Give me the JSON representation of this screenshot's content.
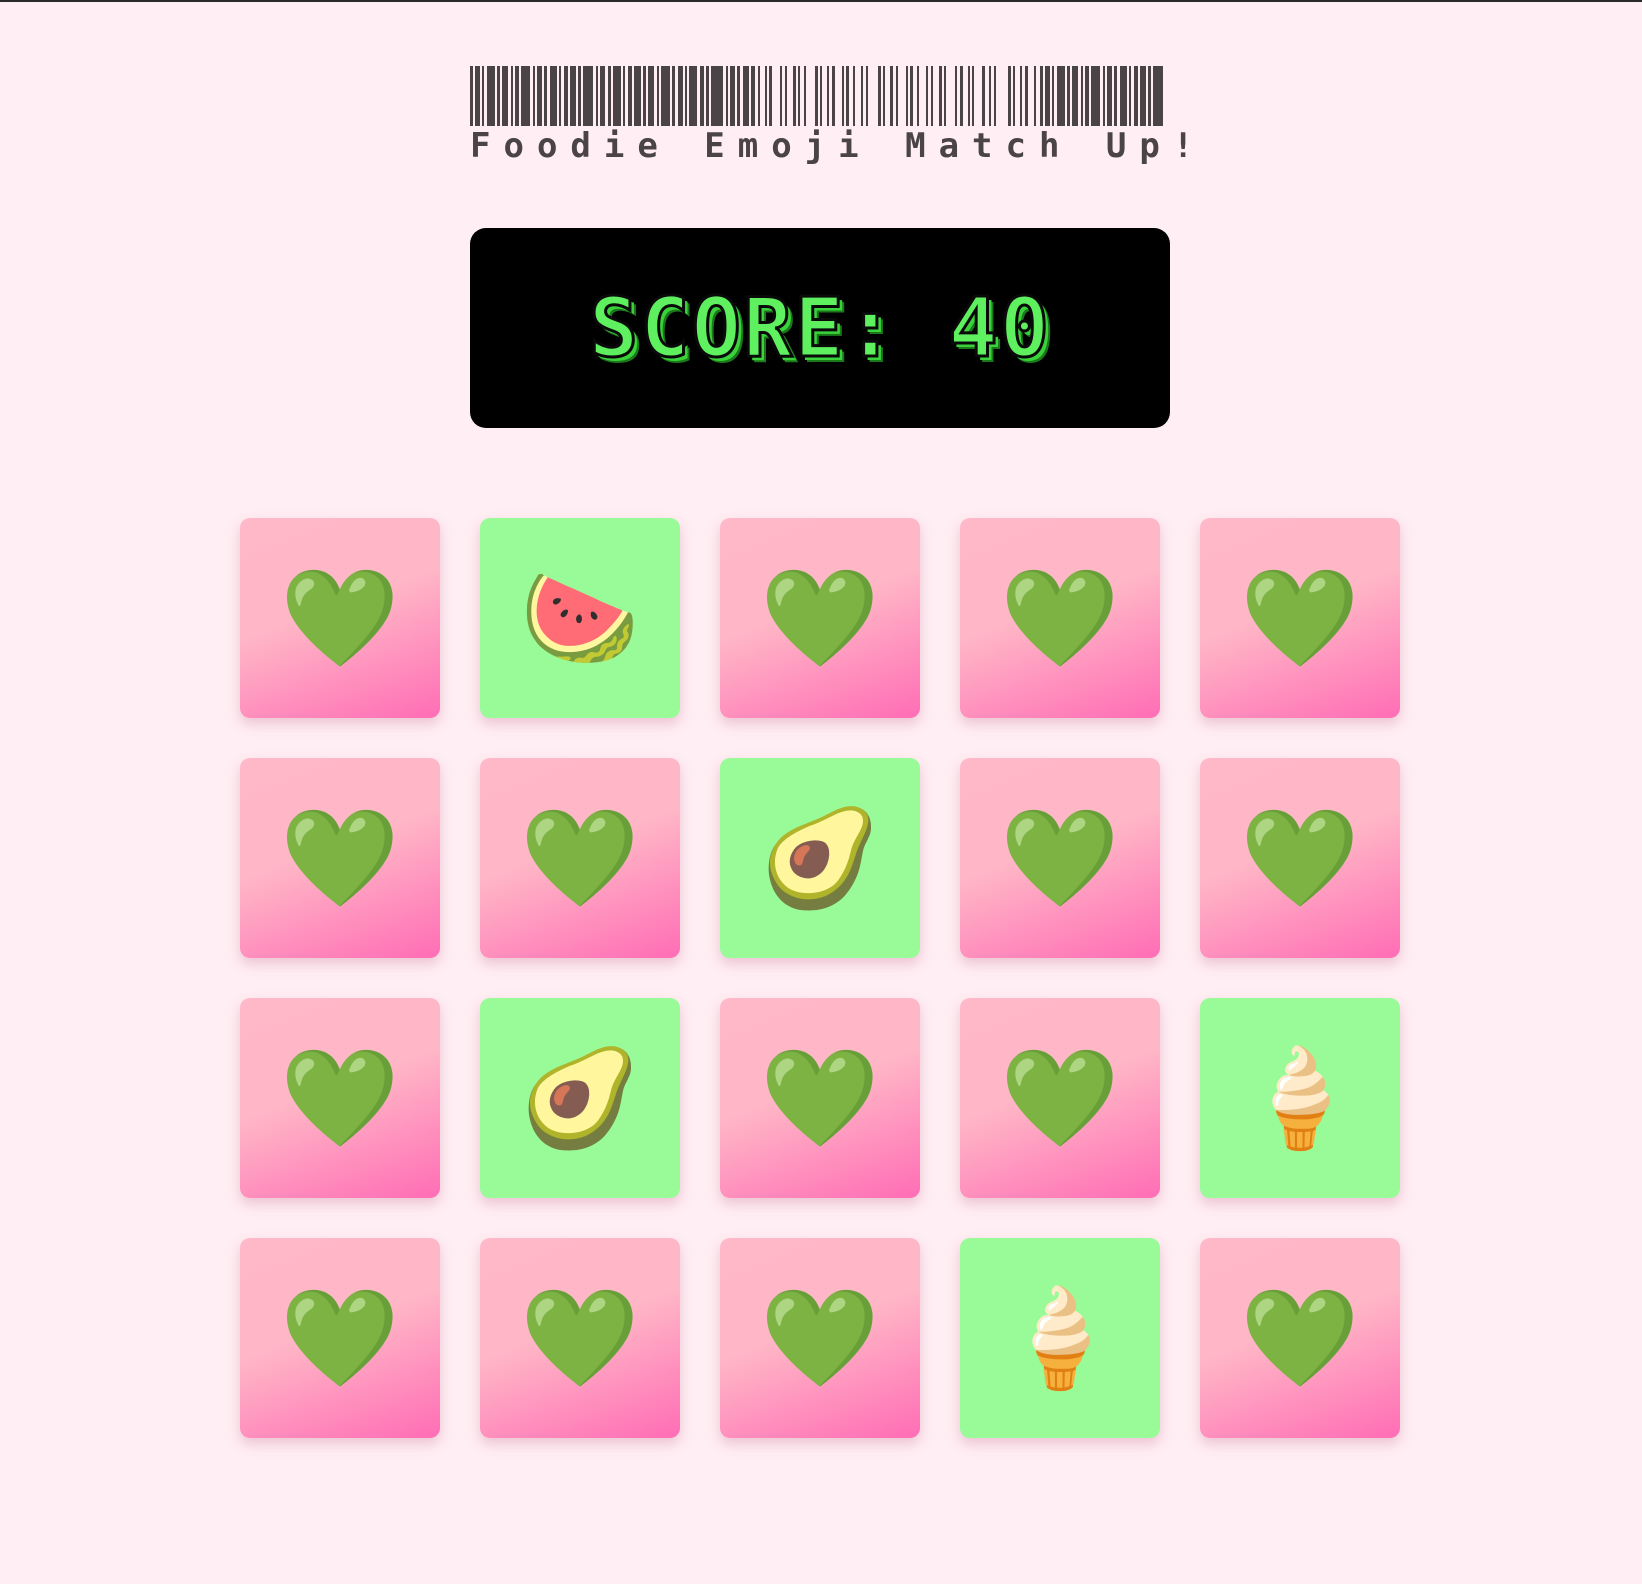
{
  "title": "Foodie Emoji Match Up!",
  "score_text": "SCORE: 40",
  "colors": {
    "background": "#ffeef3",
    "card_back_top": "#ffb8c8",
    "card_back_bottom": "#ff6db5",
    "card_revealed": "#98fb98",
    "score_panel": "#000000",
    "score_text": "#5ef05e"
  },
  "board": {
    "rows": [
      [
        {
          "state": "hidden",
          "glyph": "💚",
          "icon": "green-heart-icon"
        },
        {
          "state": "revealed",
          "glyph": "🍉",
          "icon": "watermelon-icon"
        },
        {
          "state": "hidden",
          "glyph": "💚",
          "icon": "green-heart-icon"
        },
        {
          "state": "hidden",
          "glyph": "💚",
          "icon": "green-heart-icon"
        },
        {
          "state": "hidden",
          "glyph": "💚",
          "icon": "green-heart-icon"
        }
      ],
      [
        {
          "state": "hidden",
          "glyph": "💚",
          "icon": "green-heart-icon"
        },
        {
          "state": "hidden",
          "glyph": "💚",
          "icon": "green-heart-icon"
        },
        {
          "state": "revealed",
          "glyph": "🥑",
          "icon": "avocado-icon"
        },
        {
          "state": "hidden",
          "glyph": "💚",
          "icon": "green-heart-icon"
        },
        {
          "state": "hidden",
          "glyph": "💚",
          "icon": "green-heart-icon"
        }
      ],
      [
        {
          "state": "hidden",
          "glyph": "💚",
          "icon": "green-heart-icon"
        },
        {
          "state": "revealed",
          "glyph": "🥑",
          "icon": "avocado-icon"
        },
        {
          "state": "hidden",
          "glyph": "💚",
          "icon": "green-heart-icon"
        },
        {
          "state": "hidden",
          "glyph": "💚",
          "icon": "green-heart-icon"
        },
        {
          "state": "revealed",
          "glyph": "🍦",
          "icon": "soft-ice-cream-icon"
        }
      ],
      [
        {
          "state": "hidden",
          "glyph": "💚",
          "icon": "green-heart-icon"
        },
        {
          "state": "hidden",
          "glyph": "💚",
          "icon": "green-heart-icon"
        },
        {
          "state": "hidden",
          "glyph": "💚",
          "icon": "green-heart-icon"
        },
        {
          "state": "revealed",
          "glyph": "🍦",
          "icon": "soft-ice-cream-icon"
        },
        {
          "state": "hidden",
          "glyph": "💚",
          "icon": "green-heart-icon"
        }
      ]
    ]
  }
}
